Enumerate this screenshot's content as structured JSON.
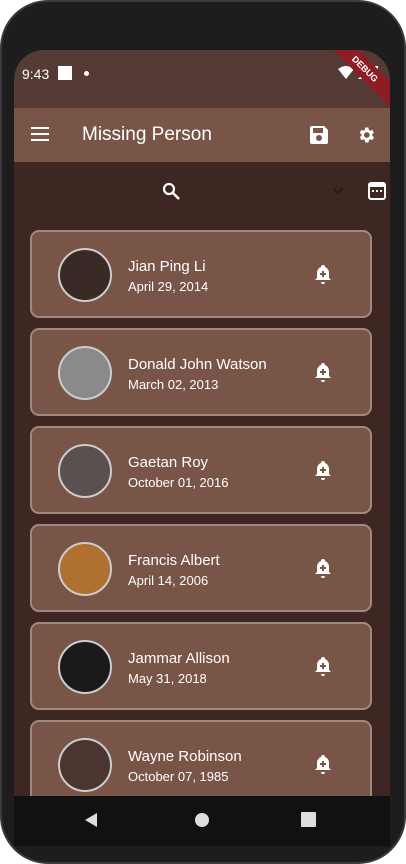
{
  "status": {
    "time": "9:43",
    "debug": "DEBUG"
  },
  "appbar": {
    "title": "Missing Person",
    "icons": [
      "menu-icon",
      "save-icon",
      "settings-icon"
    ]
  },
  "search": {
    "icons": [
      "search-icon",
      "chevron-down-icon",
      "calendar-icon"
    ]
  },
  "people": [
    {
      "name": "Jian Ping Li",
      "date": "April 29, 2014"
    },
    {
      "name": "Donald John Watson",
      "date": "March 02, 2013"
    },
    {
      "name": "Gaetan Roy",
      "date": "October 01, 2016"
    },
    {
      "name": "Francis Albert",
      "date": "April 14, 2006"
    },
    {
      "name": "Jammar Allison",
      "date": "May 31, 2018"
    },
    {
      "name": "Wayne Robinson",
      "date": "October 07, 1985"
    }
  ],
  "colors": {
    "appbar": "#795548",
    "background": "#3e2723",
    "status": "#553a35"
  }
}
